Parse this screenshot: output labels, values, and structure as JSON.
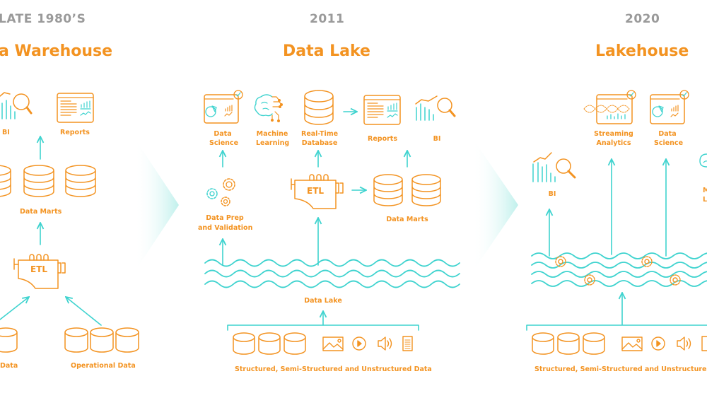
{
  "colors": {
    "orange": "#f39321",
    "teal": "#3fd3cf",
    "gray": "#9a9a9a",
    "chevron": "#bff0ec"
  },
  "panels": [
    {
      "era": "LATE 1980’S",
      "title": "a Warehouse",
      "labels": {
        "bi": "BI",
        "reports": "Reports",
        "data_marts": "Data Marts",
        "etl": "ETL",
        "source_left": "Data",
        "operational": "Operational Data"
      }
    },
    {
      "era": "2011",
      "title": "Data Lake",
      "labels": {
        "data_science_1": "Data",
        "data_science_2": "Science",
        "ml_1": "Machine",
        "ml_2": "Learning",
        "rtdb_1": "Real-Time",
        "rtdb_2": "Database",
        "reports": "Reports",
        "bi": "BI",
        "prep_1": "Data Prep",
        "prep_2": "and Validation",
        "etl": "ETL",
        "data_marts": "Data Marts",
        "lake": "Data Lake",
        "sources": "Structured, Semi-Structured and Unstructured Data"
      }
    },
    {
      "era": "2020",
      "title": "Lakehouse",
      "labels": {
        "streaming_1": "Streaming",
        "streaming_2": "Analytics",
        "data_science_1": "Data",
        "data_science_2": "Science",
        "bi": "BI",
        "ml_1": "M",
        "ml_2": "L",
        "sources": "Structured, Semi-Structured and Unstructured Data"
      }
    }
  ]
}
